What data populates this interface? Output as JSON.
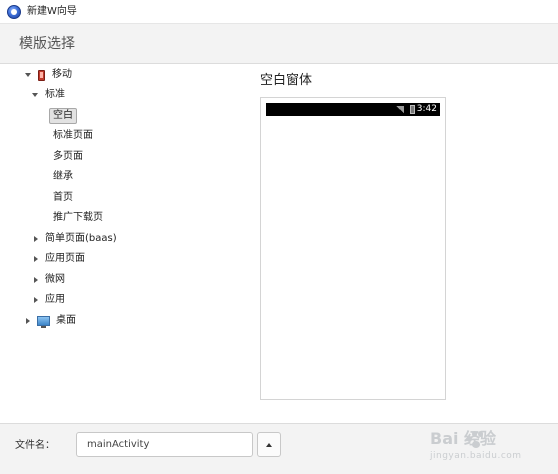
{
  "window": {
    "title": "新建W向导"
  },
  "header": {
    "title": "模版选择"
  },
  "tree": {
    "mobile": "移动",
    "standard": "标准",
    "leaves": [
      "空白",
      "标准页面",
      "多页面",
      "继承",
      "首页",
      "推广下载页"
    ],
    "groups": [
      "简单页面(baas)",
      "应用页面",
      "微网",
      "应用"
    ],
    "desktop": "桌面"
  },
  "preview": {
    "title": "空白窗体",
    "clock": "3:42"
  },
  "footer": {
    "file_label": "文件名：",
    "file_value": "mainActivity"
  },
  "watermark": {
    "brand": "Bai 经验",
    "sub": "jingyan.baidu.com"
  }
}
